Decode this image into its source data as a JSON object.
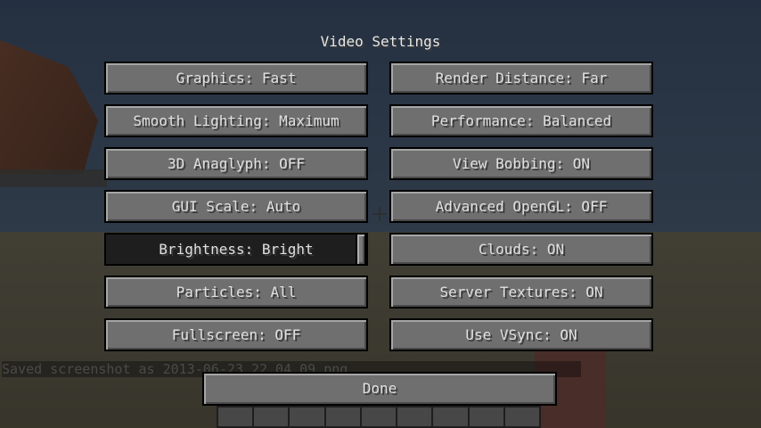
{
  "title": "Video Settings",
  "buttons": {
    "graphics": "Graphics: Fast",
    "render_distance": "Render Distance: Far",
    "smooth_lighting": "Smooth Lighting: Maximum",
    "performance": "Performance: Balanced",
    "anaglyph": "3D Anaglyph: OFF",
    "view_bobbing": "View Bobbing: ON",
    "gui_scale": "GUI Scale: Auto",
    "advanced_opengl": "Advanced OpenGL: OFF",
    "brightness": "Brightness: Bright",
    "clouds": "Clouds: ON",
    "particles": "Particles: All",
    "server_textures": "Server Textures: ON",
    "fullscreen": "Fullscreen: OFF",
    "vsync": "Use VSync: ON",
    "done": "Done"
  },
  "brightness_level": 1.0,
  "chat": {
    "message": "Saved screenshot as 2013-06-23_22.04.09.png"
  },
  "hotbar": {
    "slots": 9
  },
  "icons": {
    "crosshair": "crosshair-icon"
  }
}
